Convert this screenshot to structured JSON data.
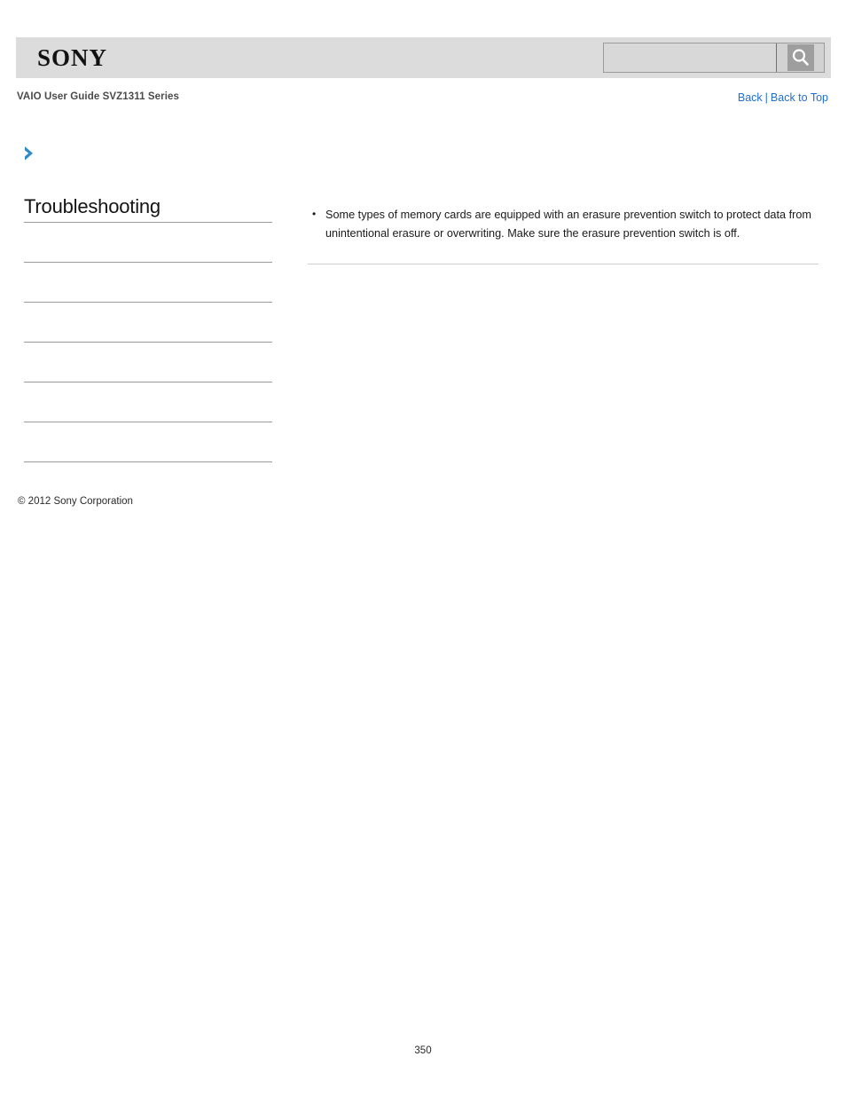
{
  "header": {
    "logo_text": "SONY",
    "logo_icon": "sony-wordmark",
    "search": {
      "value": "",
      "placeholder": "",
      "button_icon": "search-magnifier-icon"
    }
  },
  "title_bar": {
    "guide_title": "VAIO User Guide SVZ1311 Series",
    "back_label": "Back",
    "separator": "|",
    "back_to_top_label": "Back to Top",
    "link_color": "#1f6fd0"
  },
  "breadcrumb": {
    "icon": "blue-chevron-right-icon",
    "text": "",
    "color": "#2e8bc8"
  },
  "sidebar": {
    "heading": "Troubleshooting",
    "items": [
      {
        "label": ""
      },
      {
        "label": ""
      },
      {
        "label": ""
      },
      {
        "label": ""
      },
      {
        "label": ""
      },
      {
        "label": ""
      }
    ]
  },
  "content": {
    "bullets": [
      "Some types of memory cards are equipped with an erasure prevention switch to protect data from unintentional erasure or overwriting. Make sure the erasure prevention switch is off."
    ]
  },
  "footer": {
    "copyright": "© 2012 Sony Corporation",
    "page_number": "350"
  }
}
